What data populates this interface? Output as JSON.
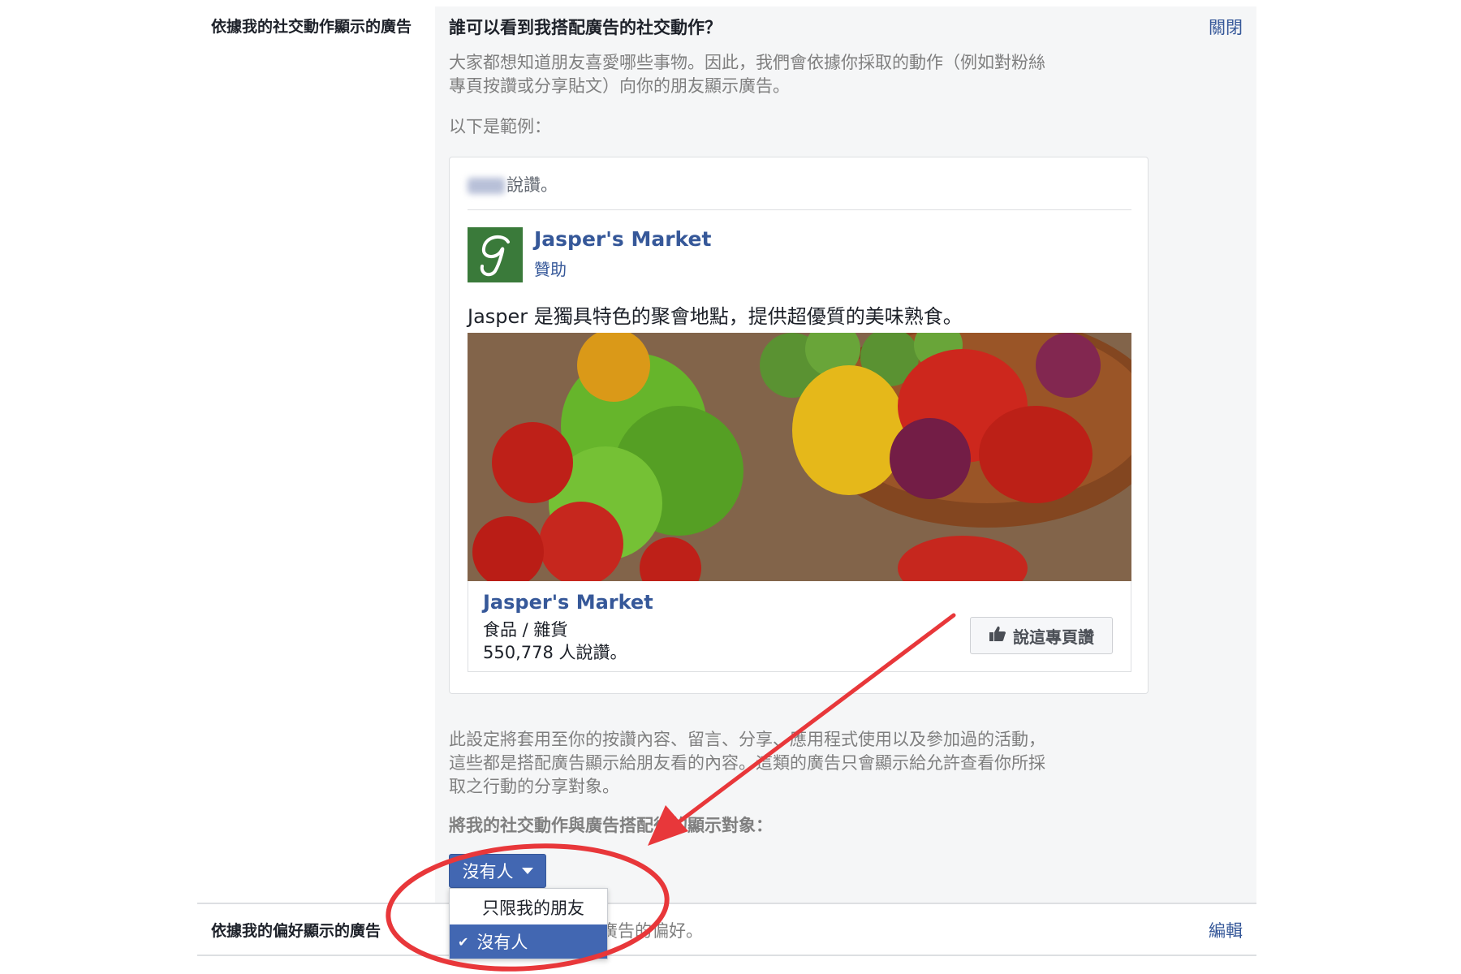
{
  "settings": {
    "row1_label": "依據我的社交動作顯示的廣告",
    "section_title": "誰可以看到我搭配廣告的社交動作？",
    "close_link": "關閉",
    "intro_line1": "大家都想知道朋友喜愛哪些事物。因此，我們會依據你採取的動作（例如對粉絲",
    "intro_line2": "專頁按讚或分享貼文）向你的朋友顯示廣告。",
    "example_heading": "以下是範例：",
    "note_line1": "此設定將套用至你的按讚內容、留言、分享、應用程式使用以及參加過的活動，",
    "note_line2": "這些都是搭配廣告顯示給朋友看的內容。這類的廣告只會顯示給允許查看你所採",
    "note_line3": "取之行動的分享對象。",
    "audience_label": "將我的社交動作與廣告搭配後的顯示對象：",
    "row2_label": "依據我的偏好顯示的廣告",
    "row2_desc": "廣告的偏好。",
    "edit_link": "編輯"
  },
  "ad_example": {
    "social_context": "說讚。",
    "page_name": "Jasper's Market",
    "sponsored": "贊助",
    "ad_text": "Jasper 是獨具特色的聚會地點，提供超優質的美味熟食。",
    "attachment_name": "Jasper's Market",
    "category": "食品 / 雜貨",
    "likes": "550,778 人說讚。",
    "like_button": "說這專頁讚"
  },
  "dropdown": {
    "selected": "沒有人",
    "options": [
      "只限我的朋友",
      "沒有人"
    ],
    "checkmark": "✔"
  },
  "colors": {
    "fb_blue": "#4267b2",
    "link_blue": "#365899",
    "annotation_red": "#e8373a"
  },
  "icons": {
    "logo": "script-j-logo",
    "like": "thumbs-up-icon",
    "caret": "caret-down-icon",
    "check": "check-icon"
  }
}
